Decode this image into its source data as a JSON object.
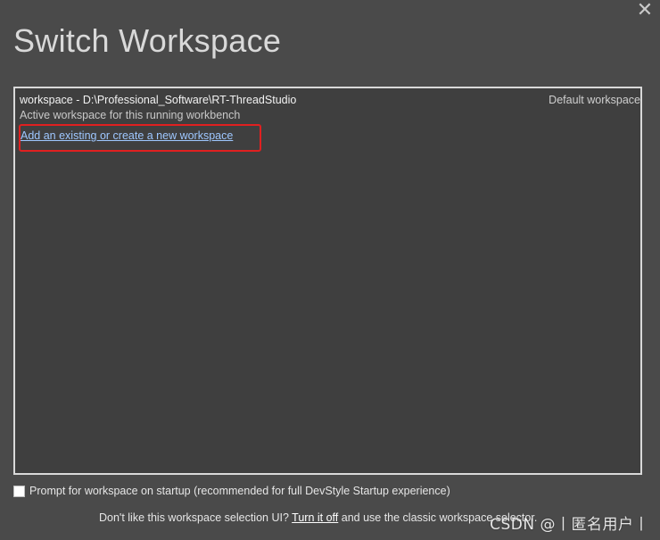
{
  "dialog": {
    "close_glyph": "✕",
    "title": "Switch Workspace"
  },
  "workspace_list": {
    "entries": [
      {
        "name": "workspace - D:\\Professional_Software\\RT-ThreadStudio",
        "default_label": "Default workspace",
        "description": "Active workspace for this running workbench"
      }
    ],
    "add_link": "Add an existing or create a new workspace"
  },
  "options": {
    "prompt_checkbox_checked": false,
    "prompt_label": "Prompt for workspace on startup (recommended for full DevStyle Startup experience)"
  },
  "footer": {
    "prefix": "Don't like this workspace selection UI? ",
    "turn_off_link": "Turn it off",
    "suffix": " and use the classic workspace selector."
  },
  "watermark": "CSDN @丨匿名用户丨",
  "colors": {
    "background": "#4a4a4a",
    "panel": "#3f3f3f",
    "link": "#9ec7ff",
    "highlight": "#e02020"
  }
}
